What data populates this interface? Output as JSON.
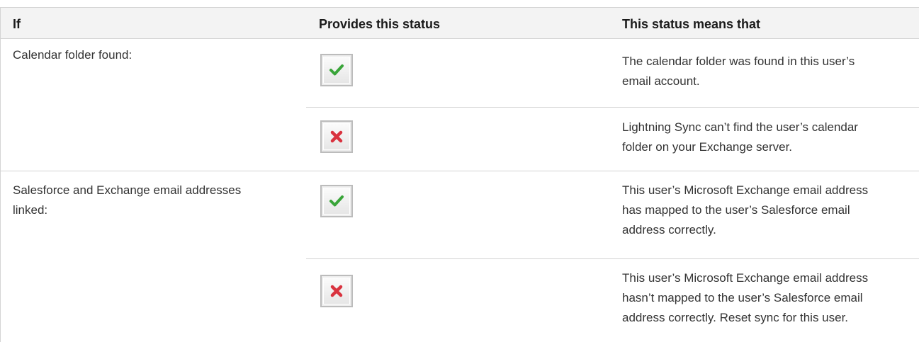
{
  "table": {
    "headers": {
      "if": "If",
      "provides": "Provides this status",
      "means": "This status means that"
    },
    "groups": [
      {
        "condition": "Calendar folder found:",
        "rows": [
          {
            "status_icon": "green-check-icon",
            "meaning_lines": [
              "The calendar folder was found in this user’s",
              "email account."
            ]
          },
          {
            "status_icon": "red-x-icon",
            "meaning_lines": [
              "Lightning Sync can’t find the user’s calendar",
              "folder on your Exchange server."
            ]
          }
        ]
      },
      {
        "condition_lines": [
          "Salesforce and Exchange email addresses",
          "linked:"
        ],
        "rows": [
          {
            "status_icon": "green-check-icon",
            "meaning_lines": [
              "This user’s Microsoft Exchange email address",
              "has mapped to the user’s Salesforce email",
              "address correctly."
            ]
          },
          {
            "status_icon": "red-x-icon",
            "meaning_lines": [
              "This user’s Microsoft Exchange email address",
              "hasn’t mapped to the user’s Salesforce email",
              "address correctly. Reset sync for this user."
            ]
          }
        ]
      }
    ],
    "colors": {
      "border": "#d4d4d4",
      "header_bg": "#f3f3f3",
      "check_green": "#3aa53a",
      "x_red": "#d9333f"
    }
  }
}
